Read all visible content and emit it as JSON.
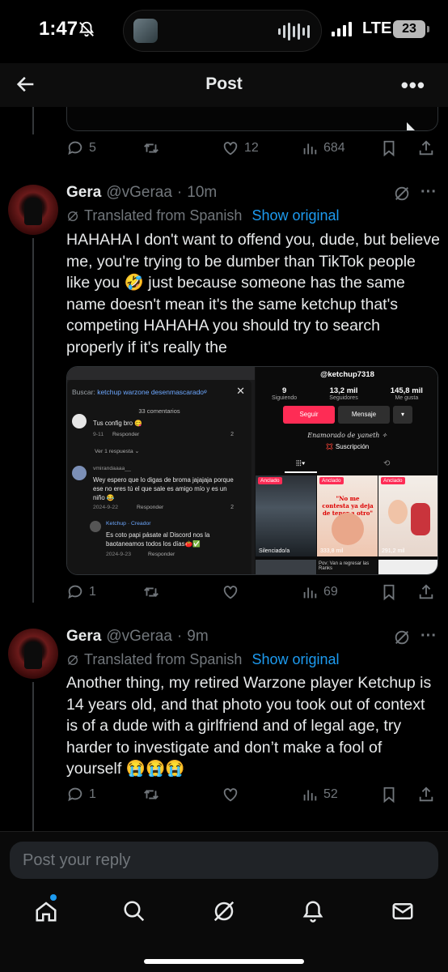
{
  "status_bar": {
    "time": "1:47",
    "network": "LTE",
    "battery": "23"
  },
  "header": {
    "title": "Post"
  },
  "prev_post": {
    "replies": "5",
    "likes": "12",
    "views": "684"
  },
  "tweets": [
    {
      "name": "Gera",
      "handle": "@vGeraa",
      "sep": "·",
      "time": "10m",
      "translated_label": "Translated from Spanish",
      "show_original": "Show original",
      "text": "HAHAHA I don't want to offend you, dude, but believe me, you're trying to be dumber than TikTok people like you 🤣 just because someone has the same name doesn't mean it's the same ketchup that's competing HAHAHA you should try to search properly if it's really the",
      "replies": "1",
      "views": "69"
    },
    {
      "name": "Gera",
      "handle": "@vGeraa",
      "sep": "·",
      "time": "9m",
      "translated_label": "Translated from Spanish",
      "show_original": "Show original",
      "text": "Another thing, my retired Warzone player Ketchup is 14 years old, and that photo you took out of context is of a dude with a girlfriend and of legal age, try harder to investigate and don’t make a fool of yourself 😭😭😭",
      "replies": "1",
      "views": "52"
    }
  ],
  "media": {
    "search_label": "Buscar:",
    "search_query": "ketchup warzone desenmascarado",
    "comment_count": "33 comentarios",
    "comments": [
      {
        "text": "Tus config bro 😋",
        "date": "9-11",
        "reply": "Responder",
        "likes": "2"
      },
      {
        "more": "Ver 1 respuesta ⌄"
      },
      {
        "user": "vmirandaaaa__",
        "text": "Wey espero que lo digas de broma jajajaja porque ese no eres tú el que sale es amigo mío y es un niño 😂",
        "date": "2024-9-22",
        "reply": "Responder",
        "likes": "2"
      },
      {
        "user": "Ketchup · Creador",
        "text": "Es coto papi pásate al Discord nos la baotaneamos todos los días🍅✅",
        "date": "2024-9-23",
        "reply": "Responder"
      }
    ],
    "profile": {
      "handle": "@ketchup7318",
      "stats": [
        {
          "n": "9",
          "l": "Siguiendo"
        },
        {
          "n": "13,2 mil",
          "l": "Seguidores"
        },
        {
          "n": "145,8 mil",
          "l": "Me gusta"
        }
      ],
      "follow": "Seguir",
      "message": "Mensaje",
      "bio": "Enamorado de yaneth ✧",
      "subscription": "💢 Suscripción",
      "pinned": "Anclado",
      "video_caption": "\"No me contesta ya deja de tener a otro\"",
      "views": [
        "Silenciado/a",
        "333,8 mil",
        "291,2 mil"
      ],
      "strip_text": "Pov: Van a regresar las Ranks"
    }
  },
  "reply_bar": {
    "placeholder": "Post your reply"
  },
  "colors": {
    "accent": "#1d9bf0",
    "muted": "#71767b",
    "tiktok_red": "#fe2c55"
  }
}
